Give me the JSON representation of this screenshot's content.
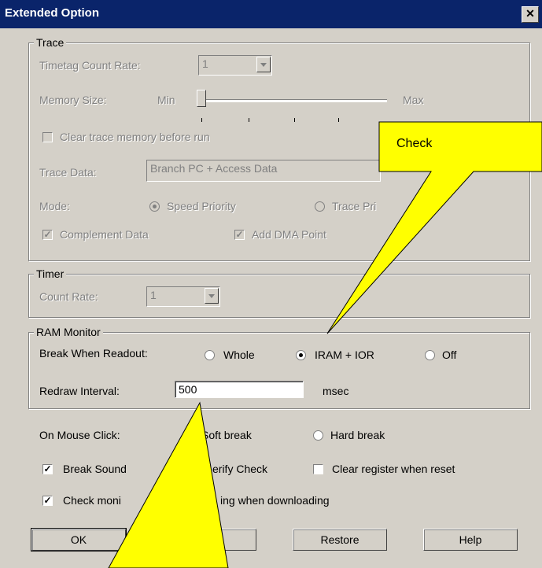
{
  "window": {
    "title": "Extended Option"
  },
  "trace": {
    "legend": "Trace",
    "timetag_label": "Timetag Count Rate:",
    "timetag_value": "1",
    "memory_label": "Memory Size:",
    "min_label": "Min",
    "max_label": "Max",
    "clear_memory_label": "Clear trace memory before run",
    "clear_memory_checked": false,
    "trace_data_label": "Trace Data:",
    "trace_data_value": "Branch PC + Access Data",
    "mode_label": "Mode:",
    "speed_priority_label": "Speed Priority",
    "trace_priority_label": "Trace Pri",
    "complement_label": "Complement Data",
    "complement_checked": true,
    "dma_label": "Add DMA Point",
    "dma_checked": true
  },
  "timer": {
    "legend": "Timer",
    "count_rate_label": "Count Rate:",
    "count_rate_value": "1"
  },
  "ram_monitor": {
    "legend": "RAM Monitor",
    "break_label": "Break When Readout:",
    "whole_label": "Whole",
    "iram_label": "IRAM + IOR",
    "off_label": "Off",
    "selected": "IRAM + IOR",
    "redraw_label": "Redraw Interval:",
    "redraw_value": "500",
    "unit": "msec"
  },
  "mouse": {
    "label": "On Mouse Click:",
    "soft_label": "Soft break",
    "hard_label": "Hard break"
  },
  "options": {
    "break_sound_label": "Break Sound",
    "verify_label": "erify Check",
    "clear_register_label": "Clear register when reset",
    "check_monitor_label_a": "Check moni",
    "check_monitor_label_b": "ing when downloading"
  },
  "buttons": {
    "ok": "OK",
    "cancel": "el",
    "restore": "Restore",
    "help": "Help"
  },
  "callout": {
    "text": "Check"
  },
  "colors": {
    "callout": "#ffff00",
    "titlebar": "#0a246a",
    "face": "#d4d0c8"
  }
}
